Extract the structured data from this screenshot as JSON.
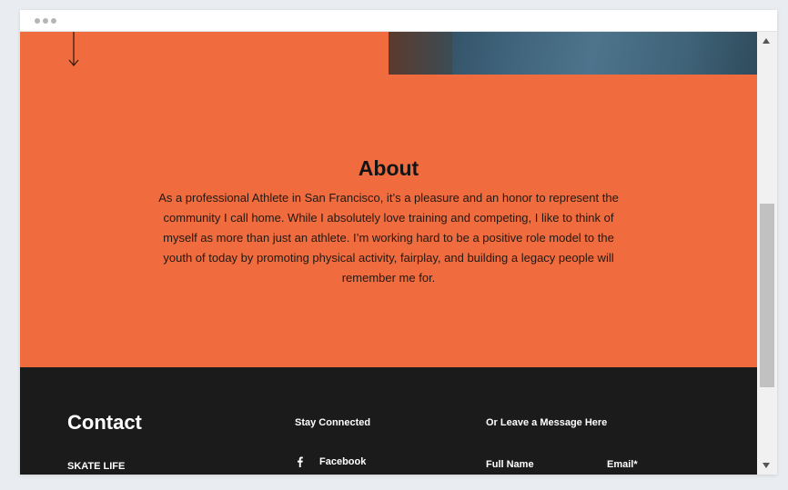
{
  "about": {
    "title": "About",
    "body": "As a professional Athlete in San Francisco, it’s a pleasure and an honor to represent the community I call home. While I absolutely love training and competing, I like to think of myself as more than just an athlete. I’m working hard to be a positive role model to the youth of today by promoting physical activity, fairplay, and building a legacy people will remember me for.",
    "background_color": "#f06c3e"
  },
  "contact": {
    "heading": "Contact",
    "brand": "SKATE LIFE",
    "stay_connected": "Stay Connected",
    "facebook_label": "Facebook",
    "message_title": "Or Leave a Message Here",
    "full_name_label": "Full Name",
    "email_label": "Email*",
    "background_color": "#1b1b1b"
  },
  "icons": {
    "scroll_down": "arrow-down-icon",
    "social": "facebook-icon",
    "window": "window-dots-icon"
  }
}
